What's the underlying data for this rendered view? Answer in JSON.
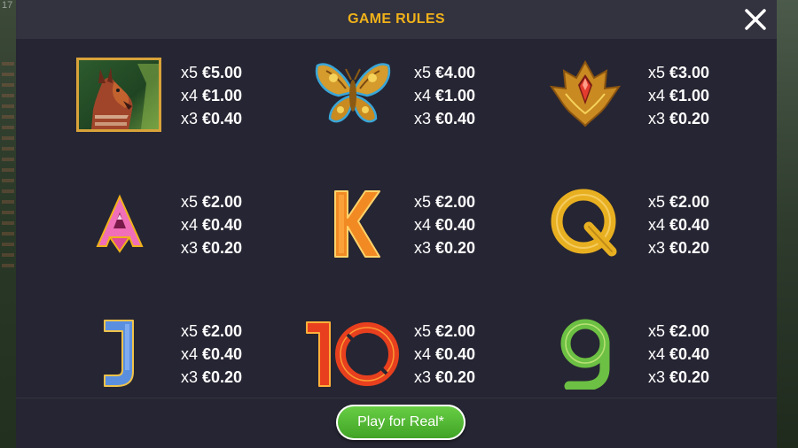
{
  "header": {
    "title": "GAME RULES",
    "close_icon": "close-icon"
  },
  "background": {
    "corner_text": "17"
  },
  "paytable": [
    {
      "symbol": "okapi",
      "icon": "okapi-icon",
      "payouts": [
        {
          "count": "x5",
          "value": "€5.00"
        },
        {
          "count": "x4",
          "value": "€1.00"
        },
        {
          "count": "x3",
          "value": "€0.40"
        }
      ]
    },
    {
      "symbol": "butterfly",
      "icon": "butterfly-icon",
      "payouts": [
        {
          "count": "x5",
          "value": "€4.00"
        },
        {
          "count": "x4",
          "value": "€1.00"
        },
        {
          "count": "x3",
          "value": "€0.40"
        }
      ]
    },
    {
      "symbol": "lotus",
      "icon": "lotus-gem-icon",
      "payouts": [
        {
          "count": "x5",
          "value": "€3.00"
        },
        {
          "count": "x4",
          "value": "€1.00"
        },
        {
          "count": "x3",
          "value": "€0.20"
        }
      ]
    },
    {
      "symbol": "A",
      "icon": "letter-a-icon",
      "payouts": [
        {
          "count": "x5",
          "value": "€2.00"
        },
        {
          "count": "x4",
          "value": "€0.40"
        },
        {
          "count": "x3",
          "value": "€0.20"
        }
      ]
    },
    {
      "symbol": "K",
      "icon": "letter-k-icon",
      "payouts": [
        {
          "count": "x5",
          "value": "€2.00"
        },
        {
          "count": "x4",
          "value": "€0.40"
        },
        {
          "count": "x3",
          "value": "€0.20"
        }
      ]
    },
    {
      "symbol": "Q",
      "icon": "letter-q-icon",
      "payouts": [
        {
          "count": "x5",
          "value": "€2.00"
        },
        {
          "count": "x4",
          "value": "€0.40"
        },
        {
          "count": "x3",
          "value": "€0.20"
        }
      ]
    },
    {
      "symbol": "J",
      "icon": "letter-j-icon",
      "payouts": [
        {
          "count": "x5",
          "value": "€2.00"
        },
        {
          "count": "x4",
          "value": "€0.40"
        },
        {
          "count": "x3",
          "value": "€0.20"
        }
      ]
    },
    {
      "symbol": "10",
      "icon": "number-10-icon",
      "payouts": [
        {
          "count": "x5",
          "value": "€2.00"
        },
        {
          "count": "x4",
          "value": "€0.40"
        },
        {
          "count": "x3",
          "value": "€0.20"
        }
      ]
    },
    {
      "symbol": "9",
      "icon": "number-9-icon",
      "payouts": [
        {
          "count": "x5",
          "value": "€2.00"
        },
        {
          "count": "x4",
          "value": "€0.40"
        },
        {
          "count": "x3",
          "value": "€0.20"
        }
      ]
    }
  ],
  "footer": {
    "play_label": "Play for Real*"
  },
  "colors": {
    "title": "#f0b21a",
    "panel": "#262533",
    "header": "#33323f",
    "button": "#4fb52f"
  }
}
